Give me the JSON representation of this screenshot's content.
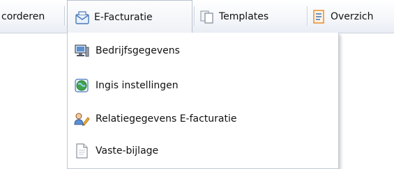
{
  "menubar": {
    "items": [
      {
        "label": "corderen",
        "icon": null
      },
      {
        "label": "E-Facturatie",
        "icon": "envelope-icon",
        "active": true
      },
      {
        "label": "Templates",
        "icon": "templates-icon"
      },
      {
        "label": "Overzich",
        "icon": "document-list-icon"
      }
    ]
  },
  "dropdown": {
    "items": [
      {
        "label": "Bedrijfsgegevens",
        "icon": "computer-icon"
      },
      {
        "label": "Ingis instellingen",
        "icon": "globe-icon"
      },
      {
        "label": "Relatiegegevens E-facturatie",
        "icon": "user-pen-icon"
      },
      {
        "label": "Vaste-bijlage",
        "icon": "blank-document-icon"
      }
    ]
  },
  "colors": {
    "menubar_bg": "#f4f6fa",
    "active_border": "#b9c2d0",
    "dropdown_border": "#c2c8d2",
    "icon_blue": "#4a78b8",
    "icon_orange": "#e8851e"
  }
}
